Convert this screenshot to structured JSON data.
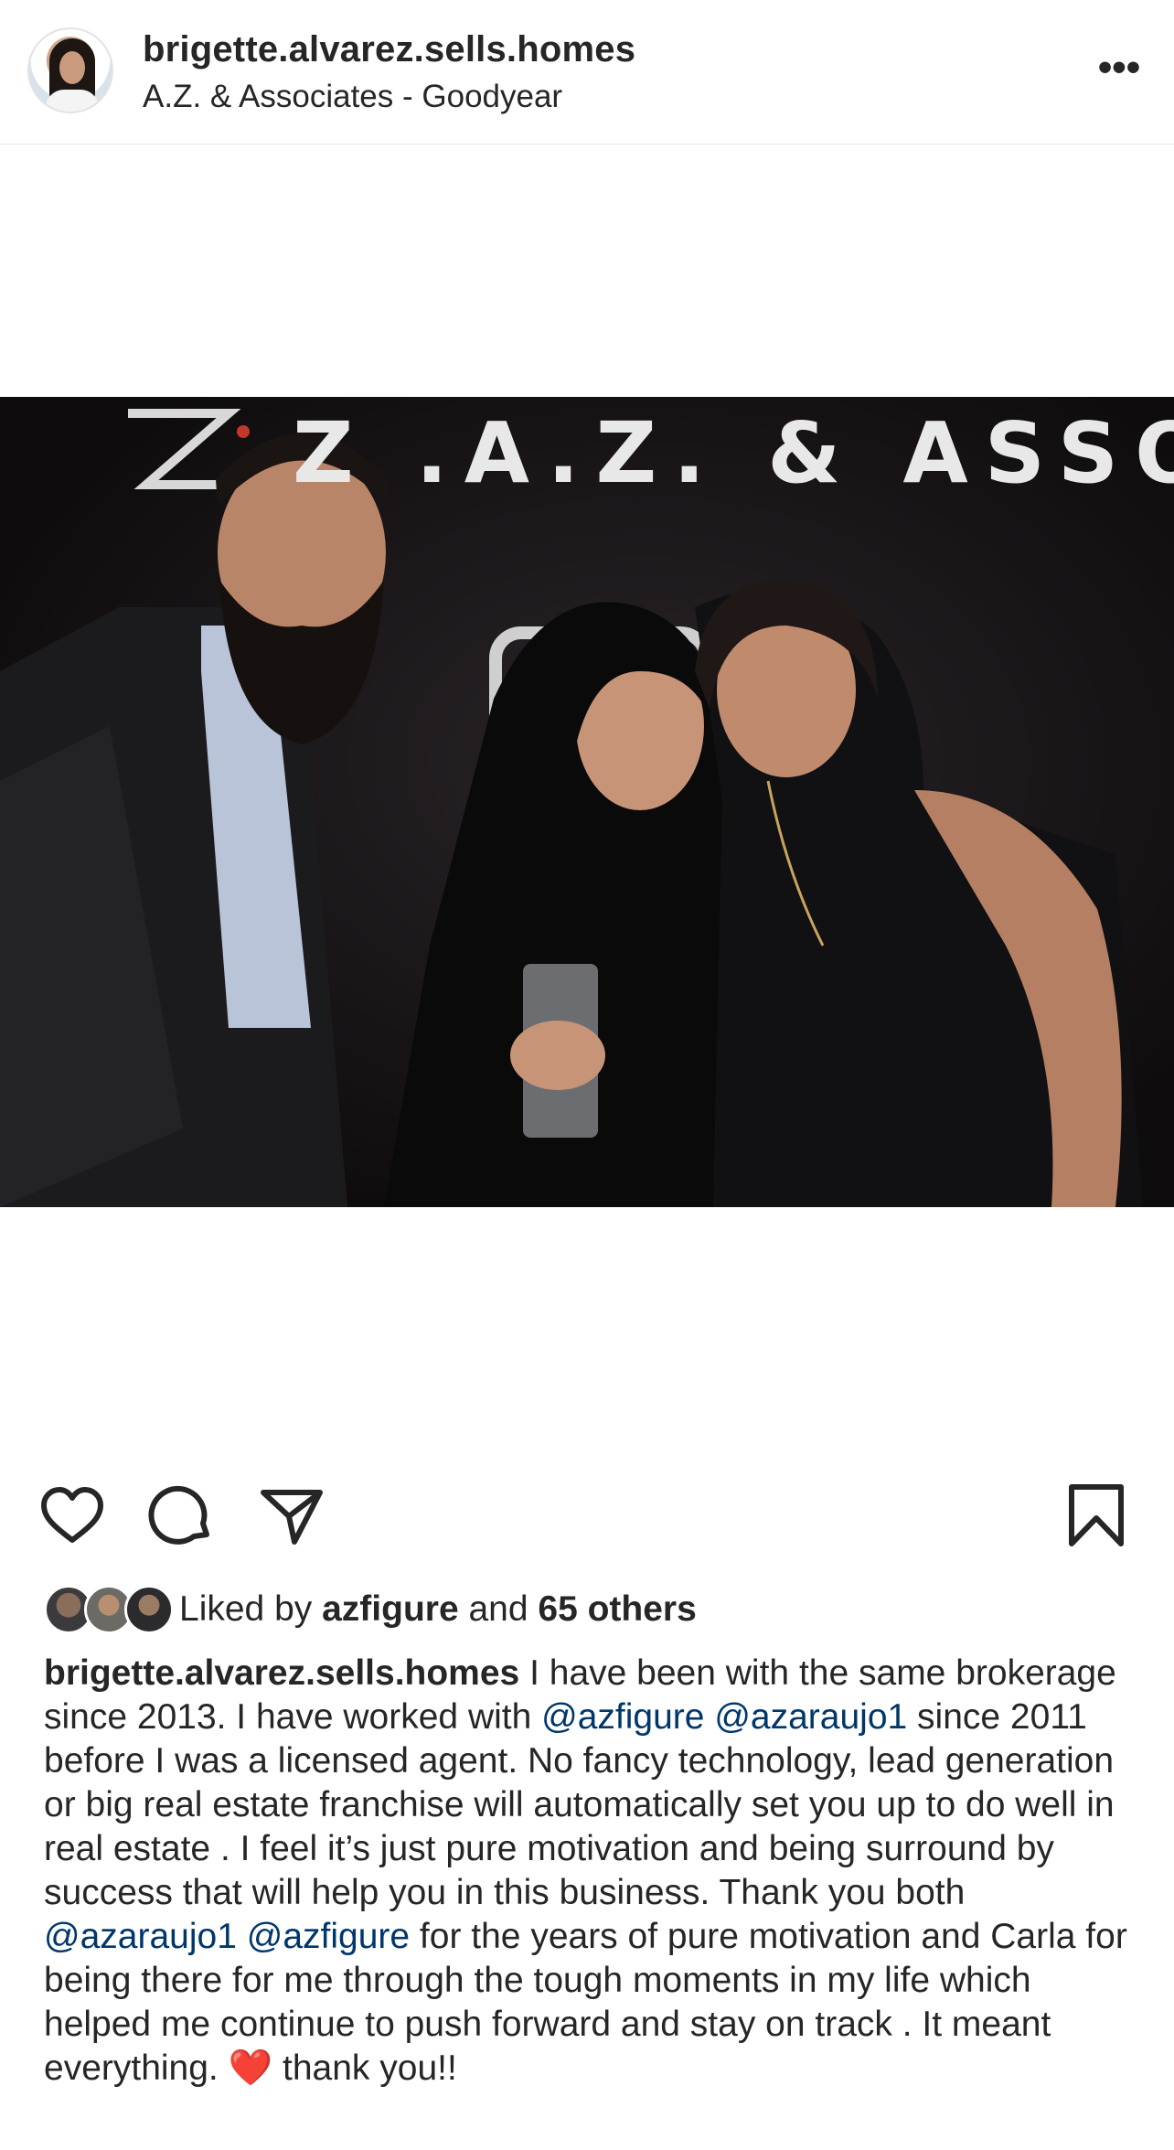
{
  "post_header": {
    "username": "brigette.alvarez.sells.homes",
    "location": "A.Z. & Associates - Goodyear",
    "more_label": "•••"
  },
  "photo": {
    "backdrop_text": "Z .A.Z. & ASSOCIATES"
  },
  "actions": {
    "like_icon": "heart-outline-icon",
    "comment_icon": "comment-bubble-icon",
    "share_icon": "paper-plane-icon",
    "save_icon": "bookmark-icon"
  },
  "likes": {
    "prefix": "Liked by ",
    "user": "azfigure",
    "middle": " and ",
    "others": "65 others"
  },
  "caption": {
    "username": "brigette.alvarez.sells.homes",
    "part1": " I have been with the same brokerage since 2013. I have worked with ",
    "mention1": "@azfigure",
    "space1": " ",
    "mention2": "@azaraujo1",
    "part2": " since 2011 before I was a licensed agent. No fancy technology, lead generation or big real estate franchise will automatically set you up to do well in real estate . I feel it’s just pure motivation and being surround by success that will help you in this business. Thank you both ",
    "mention3": "@azaraujo1",
    "space2": " ",
    "mention4": "@azfigure",
    "part3": " for the years of pure motivation and Carla for being there for me through the tough moments in my life which helped me continue to push forward and stay on track . It meant everything. ",
    "emoji": "❤️",
    "part4": " thank you!!"
  },
  "colors": {
    "text": "#262626",
    "mention": "#00376b",
    "divider": "#e6e6e6",
    "photo_bg": "#141113"
  }
}
